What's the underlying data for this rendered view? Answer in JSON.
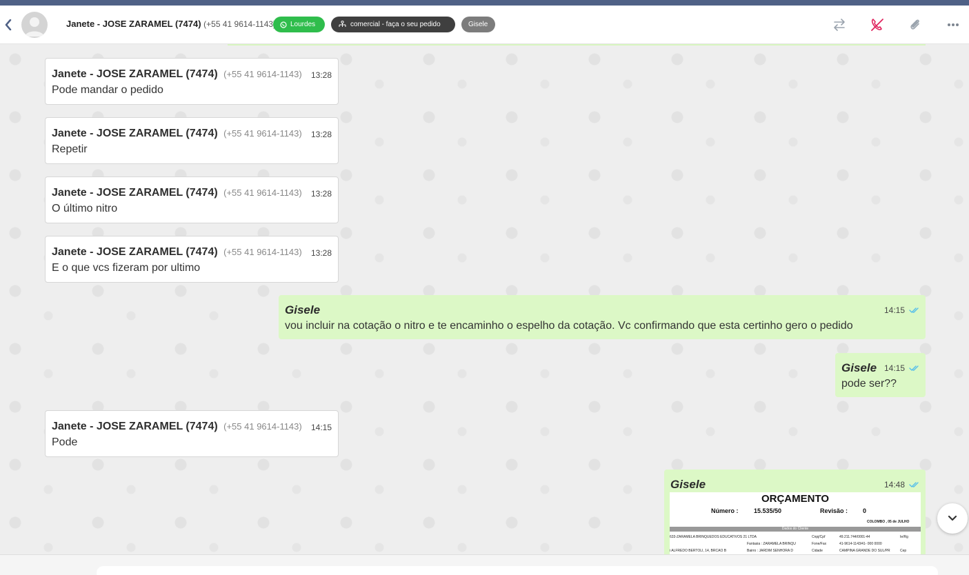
{
  "header": {
    "contact_name": "Janete - JOSE ZARAMEL (7474)",
    "contact_phone": "(+55 41 9614-1143)",
    "tags": {
      "channel": "Lourdes",
      "department": "comercial - faça o seu pedido",
      "agent": "Gisele"
    },
    "icons": [
      "transfer-icon",
      "end-call-icon",
      "attach-icon",
      "more-icon"
    ]
  },
  "messages": [
    {
      "direction": "in",
      "sender": "Janete - JOSE ZARAMEL (7474)",
      "phone": "(+55 41 9614-1143)",
      "time": "13:28",
      "text": "Pode mandar o pedido"
    },
    {
      "direction": "in",
      "sender": "Janete - JOSE ZARAMEL (7474)",
      "phone": "(+55 41 9614-1143)",
      "time": "13:28",
      "text": "Repetir"
    },
    {
      "direction": "in",
      "sender": "Janete - JOSE ZARAMEL (7474)",
      "phone": "(+55 41 9614-1143)",
      "time": "13:28",
      "text": "O último nitro"
    },
    {
      "direction": "in",
      "sender": "Janete - JOSE ZARAMEL (7474)",
      "phone": "(+55 41 9614-1143)",
      "time": "13:28",
      "text": "E o que vcs fizeram por ultimo"
    },
    {
      "direction": "out",
      "sender": "Gisele",
      "time": "14:15",
      "text": "vou incluir na cotação o nitro e te encaminho o espelho da cotação. Vc confirmando que esta certinho gero o pedido"
    },
    {
      "direction": "out",
      "sender": "Gisele",
      "time": "14:15",
      "text": "pode ser??"
    },
    {
      "direction": "in",
      "sender": "Janete - JOSE ZARAMEL (7474)",
      "phone": "(+55 41 9614-1143)",
      "time": "14:15",
      "text": "Pode"
    },
    {
      "direction": "out",
      "sender": "Gisele",
      "time": "14:48",
      "text": ""
    }
  ],
  "document_preview": {
    "title": "ORÇAMENTO",
    "numero_label": "Número :",
    "numero_value": "15.535/50",
    "revisao_label": "Revisão :",
    "revisao_value": "0",
    "location": "COLOMBO      , 05 de JULHO",
    "section": "Dados do Cliente",
    "line1": "633-ZARAMELA BRINQUEDOS EDUCATIVOS 21 LTDA",
    "line1_r1": "Cnpj/Cpf",
    "line1_r2": "49.211.744/0001-44",
    "line1_r3": "Ie/Rg",
    "line2_l": "Fantasia  :  ZARAMELA BRINQU",
    "line2_r1": "Fone/Fax",
    "line2_r2": "41-9614-1143/41- 000 0000",
    "line3": "i ALFREDO BERTOLI, 14, BRCAO B",
    "line3_m": "Bairro  :  JARDIM SENHORA D",
    "line3_r1": "Cidade",
    "line3_r2": "CAMPINA GRANDE DO SUL/PR",
    "line3_r3": "Cep"
  },
  "colors": {
    "outgoing_bubble": "#dcf8c6",
    "incoming_bubble": "#ffffff",
    "whatsapp_tag": "#2fbd4c",
    "department_tag": "#3f3f3f",
    "agent_tag": "#7c7c7c",
    "read_ticks": "#53bdeb",
    "end_call": "#e0245e"
  }
}
